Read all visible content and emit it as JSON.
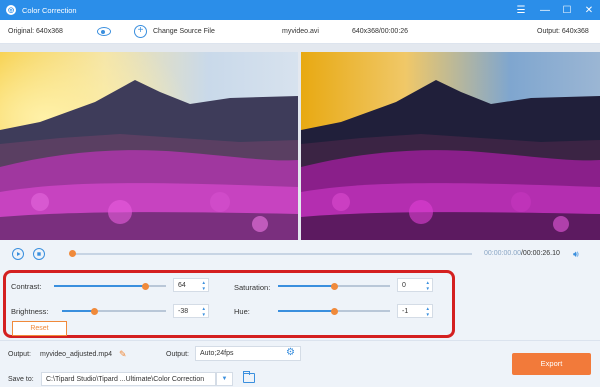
{
  "window": {
    "title": "Color Correction",
    "icon": "app-logo-icon",
    "controls": [
      "menu",
      "minimize",
      "maximize",
      "close"
    ]
  },
  "infobar": {
    "original_label": "Original: 640x368",
    "change_source": "Change Source File",
    "filename": "myvideo.avi",
    "meta": "640x368/00:00:26",
    "output_label": "Output: 640x368"
  },
  "playback": {
    "current": "00:00:00.00",
    "total": "/00:00:26.10",
    "progress": 0.0
  },
  "adjust": {
    "contrast": {
      "label": "Contrast:",
      "value": "64",
      "level": 0.82
    },
    "saturation": {
      "label": "Saturation:",
      "value": "0",
      "level": 0.5
    },
    "brightness": {
      "label": "Brightness:",
      "value": "-38",
      "level": 0.31
    },
    "hue": {
      "label": "Hue:",
      "value": "-1",
      "level": 0.5
    },
    "reset": "Reset"
  },
  "output": {
    "name_label": "Output:",
    "name_value": "myvideo_adjusted.mp4",
    "format_label": "Output:",
    "format_value": "Auto;24fps",
    "save_label": "Save to:",
    "save_path": "C:\\Tipard Studio\\Tipard ...Ultimate\\Color Correction",
    "export": "Export"
  },
  "colors": {
    "accent": "#2b8ee9",
    "orange": "#f08a3b",
    "highlight": "#d42020"
  }
}
